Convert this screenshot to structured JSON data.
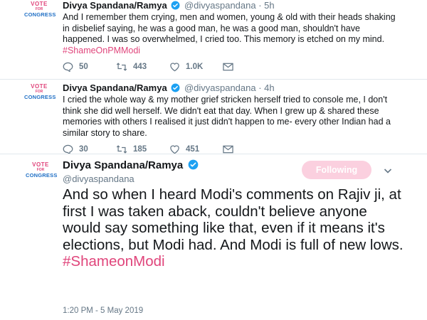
{
  "tweets": [
    {
      "name": "Divya Spandana/Ramya",
      "handle": "@divyaspandana",
      "time": "5h",
      "text": "And I remember them crying, men and women, young & old with their heads shaking in disbelief saying, he was a good man, he was a good man, shouldn't have happened. I was so overwhelmed, I cried too. This memory is etched on my mind.",
      "hashtag": "#ShameOnPMModi",
      "replies": "50",
      "retweets": "443",
      "likes": "1.0K"
    },
    {
      "name": "Divya Spandana/Ramya",
      "handle": "@divyaspandana",
      "time": "4h",
      "text": "I cried the whole way & my mother grief stricken herself tried to console me, I don't think she did well herself. We didn't eat that day. When I grew up & shared these memories with others I realised it just didn't happen to me- every other Indian had a similar story to share.",
      "replies": "30",
      "retweets": "185",
      "likes": "451"
    }
  ],
  "main_tweet": {
    "name": "Divya Spandana/Ramya",
    "handle": "@divyaspandana",
    "follow_label": "Following",
    "text": "And so when I heard Modi's comments on Rajiv ji, at first I was taken aback, couldn't believe anyone would say something like that, even if it means it's elections, but Modi had. And Modi is full of new lows.",
    "hashtag": "#ShameonModi",
    "timestamp": "1:20 PM - 5 May 2019"
  },
  "avatar": {
    "line1": "VOTE",
    "line2": "FOR",
    "line3": "CONGRESS"
  },
  "colors": {
    "accent_pink": "#e0457b",
    "verified_blue": "#1da1f2",
    "muted": "#657786"
  },
  "icons": [
    "reply-icon",
    "retweet-icon",
    "like-icon",
    "mail-icon",
    "verified-icon",
    "chevron-down-icon"
  ]
}
